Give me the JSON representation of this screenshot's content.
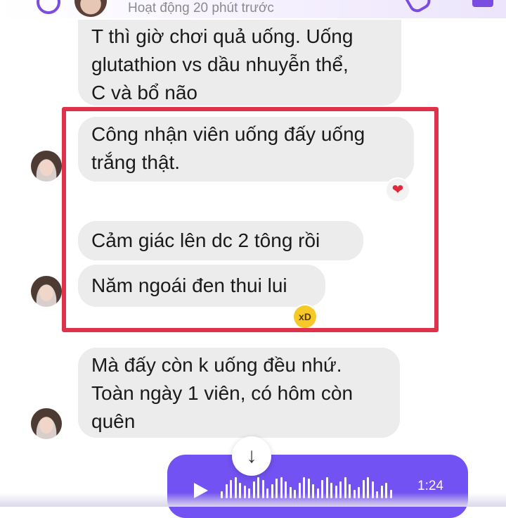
{
  "header": {
    "status_text": "Hoạt động 20 phút trước"
  },
  "messages": [
    {
      "lines": [
        "T thì giờ chơi quả uống. Uống",
        "glutathion vs dầu nhuyễn thể,",
        "C và bổ não"
      ]
    },
    {
      "lines": [
        "Công nhận viên uống đấy uống",
        "trắng thật."
      ],
      "reaction": "heart"
    },
    {
      "lines": [
        "Cảm giác lên dc 2 tông rồi"
      ]
    },
    {
      "lines": [
        "Năm ngoái đen thui lui"
      ],
      "reaction": "laughing-face"
    },
    {
      "lines": [
        "Mà đấy còn k uống đều nhứ.",
        "Toàn ngày 1 viên, có hôm còn",
        "quên"
      ]
    }
  ],
  "audio_message": {
    "duration": "1:24"
  },
  "colors": {
    "highlight_border": "#e0314a",
    "accent": "#7252f2",
    "bubble_bg": "#ececec"
  },
  "icons": {
    "scroll_down": "↓",
    "heart": "❤",
    "laugh": "xD"
  }
}
